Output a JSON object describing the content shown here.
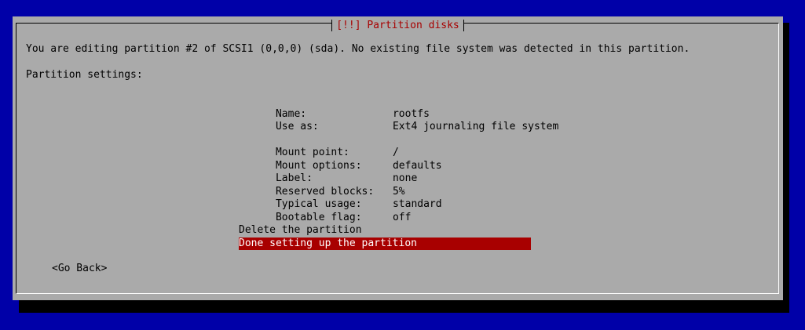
{
  "dialog": {
    "title": "[!!] Partition disks",
    "intro": "You are editing partition #2 of SCSI1 (0,0,0) (sda). No existing file system was detected in this partition.",
    "settings_label": "Partition settings:"
  },
  "settings": [
    {
      "key": "Name:",
      "value": "rootfs"
    },
    {
      "key": "Use as:",
      "value": "Ext4 journaling file system"
    },
    {
      "key": "Mount point:",
      "value": "/"
    },
    {
      "key": "Mount options:",
      "value": "defaults"
    },
    {
      "key": "Label:",
      "value": "none"
    },
    {
      "key": "Reserved blocks:",
      "value": "5%"
    },
    {
      "key": "Typical usage:",
      "value": "standard"
    },
    {
      "key": "Bootable flag:",
      "value": "off"
    }
  ],
  "actions": [
    {
      "label": "Delete the partition",
      "selected": false
    },
    {
      "label": "Done setting up the partition",
      "selected": true
    }
  ],
  "go_back_label": "<Go Back>",
  "colors": {
    "background": "#0000a8",
    "dialog": "#aaaaaa",
    "highlight": "#a80000",
    "title": "#a80000"
  }
}
